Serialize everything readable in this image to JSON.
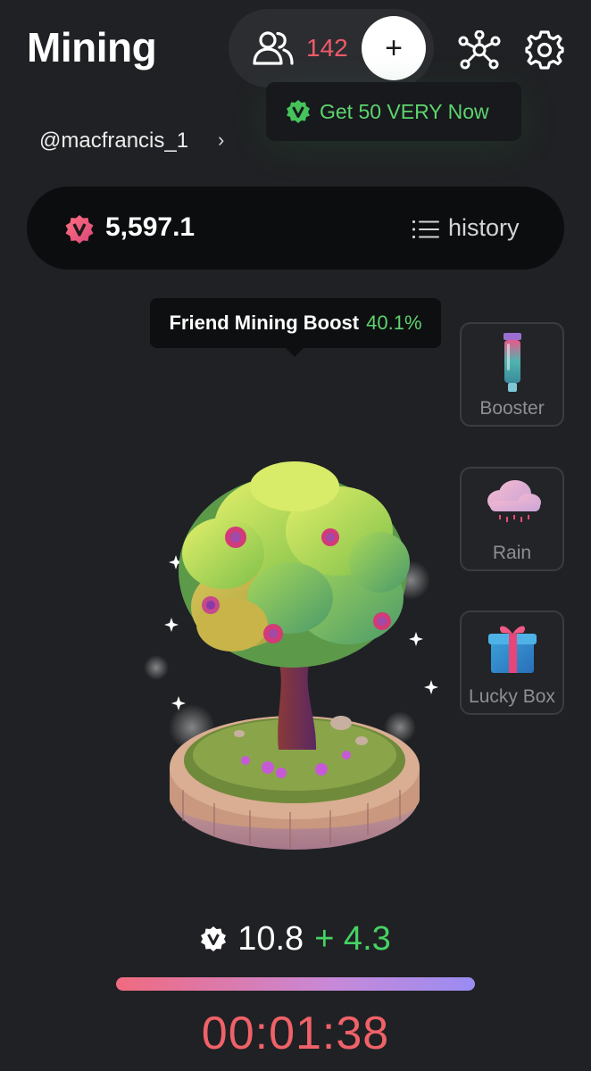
{
  "header": {
    "title": "Mining",
    "friend_count": "142",
    "add_label": "+",
    "icons": [
      "friends-icon",
      "add-icon",
      "network-icon",
      "gear-icon"
    ]
  },
  "promo": {
    "label": "Get 50 VERY Now",
    "badge_icon": "very-logo-icon"
  },
  "user": {
    "handle": "@macfrancis_1",
    "chevron": "›"
  },
  "balance": {
    "value": "5,597.1",
    "history_label": "history",
    "coin_icon": "very-coin-icon"
  },
  "boost": {
    "label": "Friend Mining Boost",
    "value": "40.1%"
  },
  "side_actions": [
    {
      "label": "Booster",
      "icon": "booster-vial-icon"
    },
    {
      "label": "Rain",
      "icon": "rain-cloud-icon"
    },
    {
      "label": "Lucky Box",
      "icon": "gift-box-icon"
    }
  ],
  "mining": {
    "rate_base": "10.8",
    "rate_bonus": "+ 4.3",
    "progress_fraction": 1.0,
    "timer": "00:01:38"
  },
  "colors": {
    "background": "#202124",
    "accent_red": "#ef6268",
    "accent_green": "#46d264",
    "promo_green": "#5ed36e"
  }
}
